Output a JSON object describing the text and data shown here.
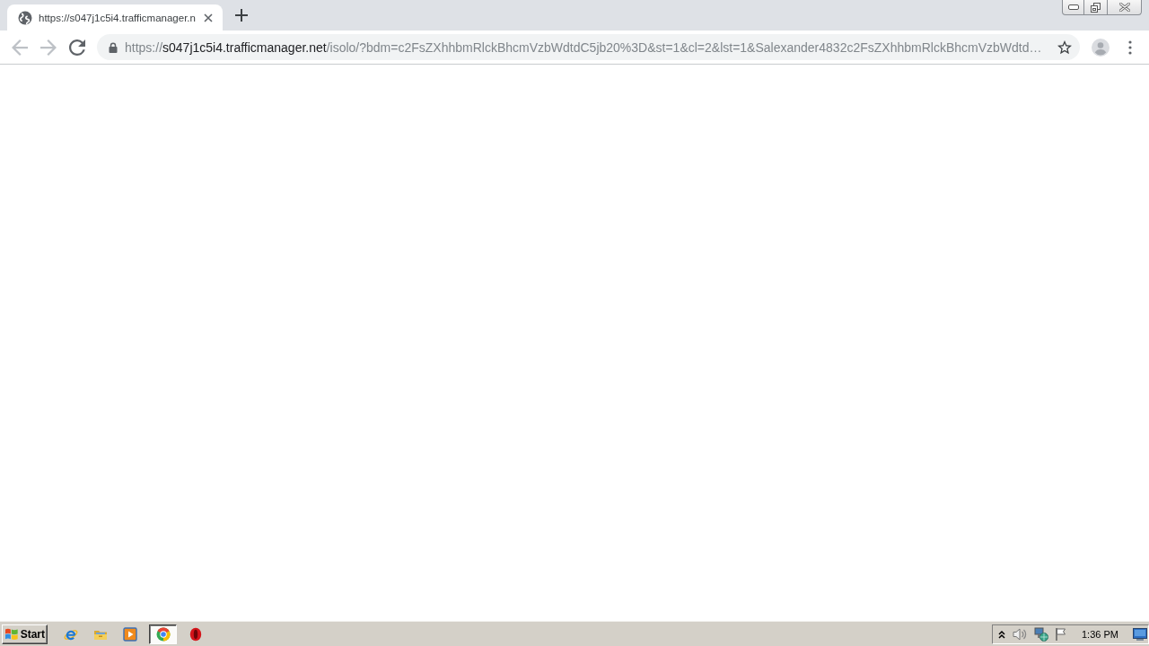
{
  "window": {
    "tabs": [
      {
        "title": "https://s047j1c5i4.trafficmanager.n",
        "selected": true
      }
    ],
    "controls": [
      {
        "kind": "minimize"
      },
      {
        "kind": "restore"
      },
      {
        "kind": "close"
      }
    ]
  },
  "toolbar": {
    "nav": [
      {
        "kind": "back",
        "disabled": true
      },
      {
        "kind": "forward",
        "disabled": true
      },
      {
        "kind": "reload",
        "disabled": false
      }
    ],
    "address": {
      "scheme": "https://",
      "host": "s047j1c5i4.trafficmanager.net",
      "path": "/isolo/?bdm=c2FsZXhhbmRlckBhcmVzbWdtdC5jb20%3D&st=1&cl=2&lst=1&Salexander4832c2FsZXhhbmRlckBhcmVzbWdtd…"
    }
  },
  "taskbar": {
    "start": "Start",
    "apps": [
      {
        "kind": "ie",
        "selected": false
      },
      {
        "kind": "folder",
        "selected": false
      },
      {
        "kind": "media",
        "selected": false
      },
      {
        "kind": "chrome",
        "selected": true
      },
      {
        "kind": "opera",
        "selected": false
      }
    ],
    "tray": [
      {
        "kind": "chevron"
      },
      {
        "kind": "speaker"
      },
      {
        "kind": "network"
      },
      {
        "kind": "flag"
      }
    ],
    "clock": "1:36 PM"
  }
}
